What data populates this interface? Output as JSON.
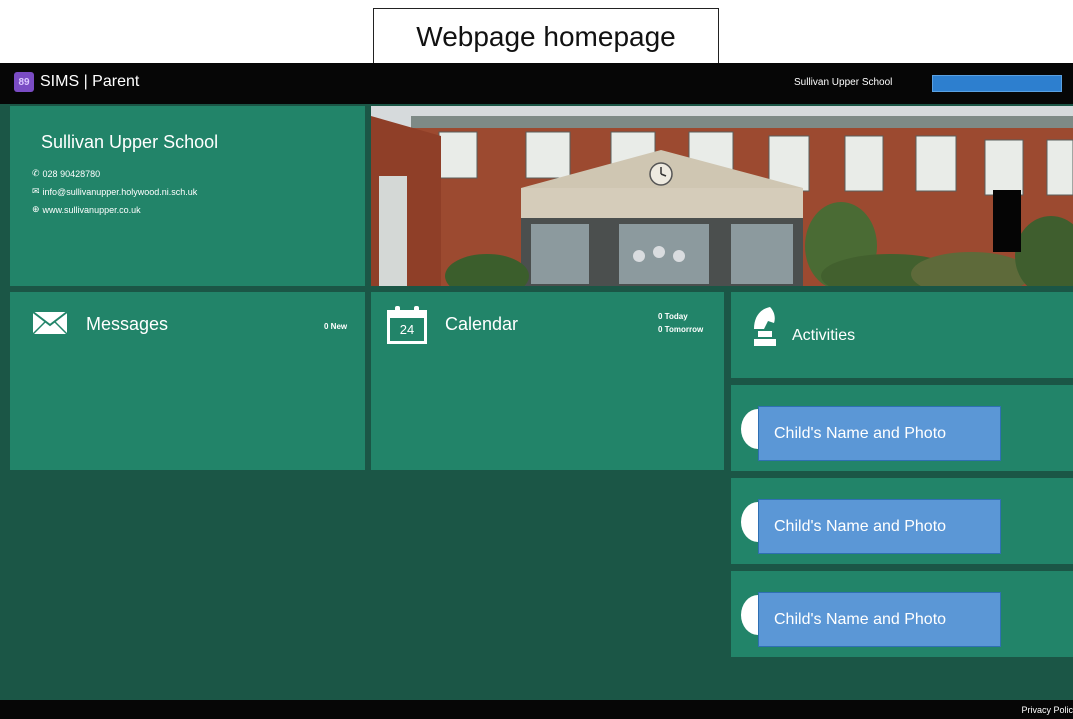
{
  "caption": "Webpage homepage",
  "header": {
    "logo_text": "89",
    "app_title": "SIMS | Parent",
    "school_name": "Sullivan Upper School"
  },
  "school_info": {
    "name": "Sullivan Upper School",
    "phone": "028 90428780",
    "email": "info@sullivanupper.holywood.ni.sch.uk",
    "website": "www.sullivanupper.co.uk",
    "icons": [
      "phone-icon",
      "envelope-icon",
      "globe-icon"
    ]
  },
  "messages": {
    "title": "Messages",
    "count": "0 New"
  },
  "calendar": {
    "title": "Calendar",
    "day": "24",
    "today": "0 Today",
    "tomorrow": "0 Tomorrow"
  },
  "activities": {
    "title": "Activities"
  },
  "children": [
    {
      "label": "Child's Name and Photo"
    },
    {
      "label": "Child's Name and Photo"
    },
    {
      "label": "Child's Name and Photo"
    }
  ],
  "footer": {
    "privacy": "Privacy Polic"
  },
  "colors": {
    "tile": "#228469",
    "background": "#1b5646",
    "bar": "#060606",
    "button": "#5b97d6"
  }
}
